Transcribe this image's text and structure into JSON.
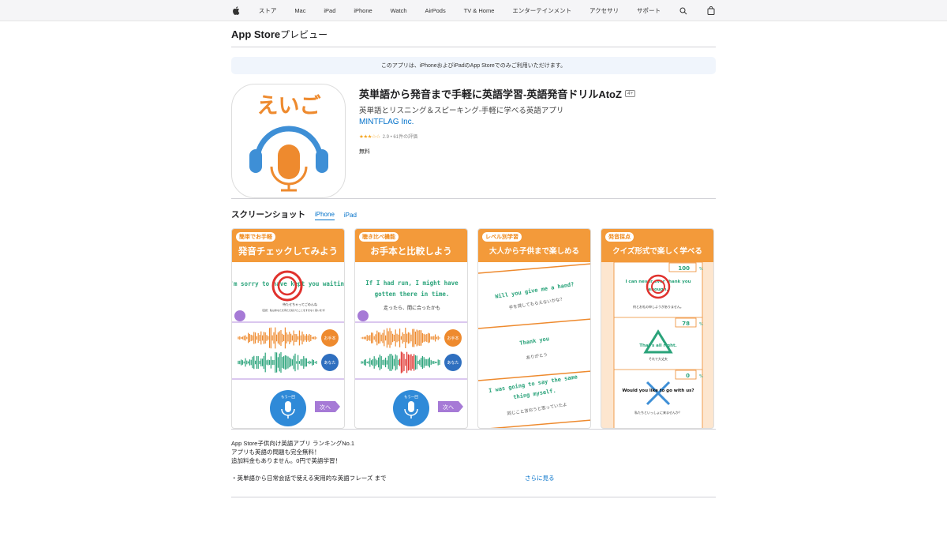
{
  "nav": {
    "items": [
      "ストア",
      "Mac",
      "iPad",
      "iPhone",
      "Watch",
      "AirPods",
      "TV & Home",
      "エンターテインメント",
      "アクセサリ",
      "サポート"
    ]
  },
  "local": {
    "brand": "App Store",
    "brand_suffix": "プレビュー"
  },
  "banner": "このアプリは、iPhoneおよびiPadのApp Storeでのみご利用いただけます。",
  "app": {
    "icon_text": "えいご",
    "title": "英単語から発音まで手軽に英語学習-英語発音ドリルAtoZ",
    "age": "4+",
    "subtitle": "英単語とリスニング＆スピーキング-手軽に学べる英語アプリ",
    "developer": "MINTFLAG Inc.",
    "rating_text": "2.9 • 61件の評価",
    "rating_value": 2.9,
    "price": "無料"
  },
  "screenshots": {
    "title": "スクリーンショット",
    "tabs": [
      "iPhone",
      "iPad"
    ],
    "active_tab": 0,
    "items": [
      {
        "tag": "簡単でお手軽",
        "headline": "発音チェックしてみよう",
        "en": "I'm sorry to have kept you waiting.",
        "jp": "待たせちゃってごめんね",
        "jp2": "（直訳：私はあなたを待たせ続けたことをすまなく思います）",
        "btn1": "お手本",
        "btn2": "あなた",
        "again": "もう一回",
        "next": "次へ"
      },
      {
        "tag": "聴き比べ機能",
        "headline": "お手本と比較しよう",
        "en": "If I had run, I might have gotten there in time.",
        "jp": "走ったら、間に合ったかも",
        "btn1": "お手本",
        "btn2": "あなた",
        "again": "もう一回",
        "next": "次へ"
      },
      {
        "tag": "レベル別学習",
        "headline": "大人から子供まで楽しめる",
        "phrases": [
          {
            "en": "Will you give me a hand?",
            "jp": "手を貸してもらえないかな？"
          },
          {
            "en": "Thank you",
            "jp": "ありがとう"
          },
          {
            "en": "I was going to say the same thing myself.",
            "jp": "同じこと言おうと思っていたよ"
          }
        ]
      },
      {
        "tag": "発音採点",
        "headline": "クイズ形式で楽しく学べる",
        "quiz": [
          {
            "score": "100",
            "en": "I can never ever thank you enough.",
            "jp": "何とお礼の申しようがありません。"
          },
          {
            "score": "78",
            "en": "That's all right.",
            "jp": "それで大丈夫"
          },
          {
            "score": "0",
            "en": "Would you like to go with us?",
            "jp": "私たちといっしょに来ませんか？"
          }
        ],
        "percent": "%"
      }
    ]
  },
  "description": {
    "lines": [
      "App Store子供向け英語アプリ ランキングNo.1",
      "アプリも英語の問題も完全無料！",
      "追加料金もありません。0円で英語学習！",
      "",
      "・英単語から日常会話で使える実用的な英語フレーズ まで"
    ],
    "more": "さらに見る"
  },
  "colors": {
    "accent": "#0070c9",
    "orange": "#f39a3a",
    "blue": "#3e8fd6",
    "green": "#2aa37a"
  }
}
